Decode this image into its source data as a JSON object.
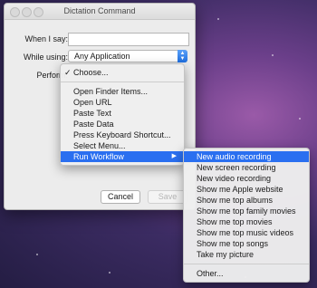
{
  "window": {
    "title": "Dictation Command"
  },
  "form": {
    "when_label": "When I say:",
    "when_value": "",
    "while_label": "While using:",
    "while_value": "Any Application",
    "perform_label": "Perform:"
  },
  "buttons": {
    "cancel": "Cancel",
    "save": "Save"
  },
  "perform_menu": {
    "checked": "Choose...",
    "items": [
      "Open Finder Items...",
      "Open URL",
      "Paste Text",
      "Paste Data",
      "Press Keyboard Shortcut...",
      "Select Menu...",
      "Run Workflow"
    ]
  },
  "workflow_menu": {
    "items": [
      "New audio recording",
      "New screen recording",
      "New video recording",
      "Show me Apple website",
      "Show me top albums",
      "Show me top family movies",
      "Show me top movies",
      "Show me top music videos",
      "Show me top songs",
      "Take my picture"
    ],
    "other": "Other..."
  },
  "colors": {
    "selection": "#2a6ff0",
    "popup_accent": "#1f6fe0"
  }
}
